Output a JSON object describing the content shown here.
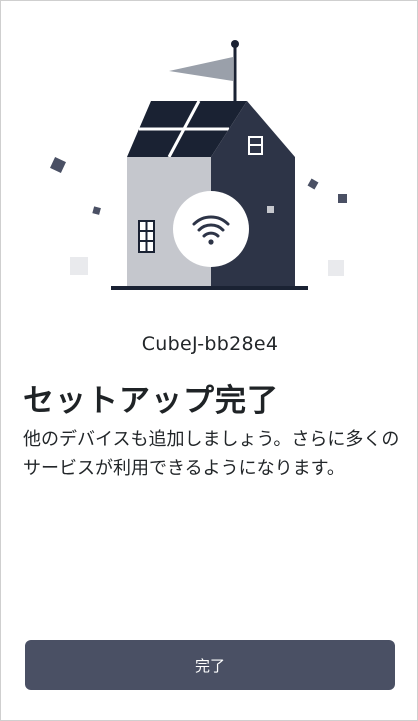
{
  "device": {
    "name": "CubeJ-bb28e4"
  },
  "setup": {
    "title": "セットアップ完了",
    "description": "他のデバイスも追加しましょう。さらに多くのサービスが利用できるようになります。"
  },
  "actions": {
    "done_label": "完了"
  },
  "colors": {
    "dark_navy": "#2d3447",
    "roof_dark": "#1a2233",
    "light_wall": "#c5c7cd",
    "flag": "#9aa0aa",
    "button": "#4a5064"
  },
  "icons": [
    "house-illustration",
    "wifi-icon",
    "flag-icon",
    "solar-panel"
  ]
}
